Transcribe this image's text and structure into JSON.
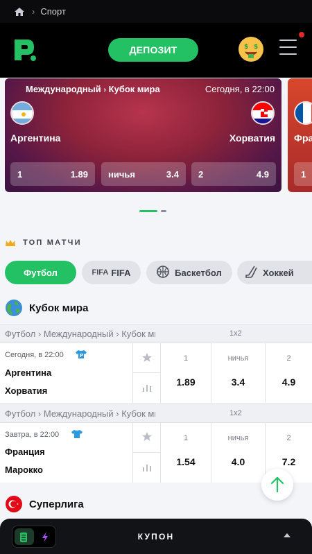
{
  "breadcrumb": {
    "page": "Спорт"
  },
  "header": {
    "deposit_label": "ДЕПОЗИТ"
  },
  "promo": {
    "league": "Международный",
    "tournament": "Кубок мира",
    "time": "Сегодня, в 22:00",
    "home": "Аргентина",
    "away": "Хорватия",
    "odds": [
      {
        "label": "1",
        "value": "1.89"
      },
      {
        "label": "ничья",
        "value": "3.4"
      },
      {
        "label": "2",
        "value": "4.9"
      }
    ],
    "next_away_partial": "Фра",
    "next_odd_partial": "1"
  },
  "top_matches": {
    "title": "ТОП МАТЧИ",
    "chips": [
      {
        "label": "Футбол",
        "active": true
      },
      {
        "label": "FIFA",
        "active": false
      },
      {
        "label": "Баскетбол",
        "active": false
      },
      {
        "label": "Хоккей",
        "active": false
      }
    ]
  },
  "leagues": [
    {
      "name": "Кубок мира",
      "matches": [
        {
          "path": "Футбол › Международный › Кубок мира",
          "market": "1x2",
          "when": "Сегодня, в 22:00",
          "home": "Аргентина",
          "away": "Хорватия",
          "odds": [
            {
              "label": "1",
              "value": "1.89"
            },
            {
              "label": "ничья",
              "value": "3.4"
            },
            {
              "label": "2",
              "value": "4.9"
            }
          ]
        },
        {
          "path": "Футбол › Международный › Кубок мира",
          "market": "1x2",
          "when": "Завтра, в 22:00",
          "home": "Франция",
          "away": "Марокко",
          "odds": [
            {
              "label": "1",
              "value": "1.54"
            },
            {
              "label": "ничья",
              "value": "4.0"
            },
            {
              "label": "2",
              "value": "7.2"
            }
          ]
        }
      ]
    },
    {
      "name": "Суперлига"
    }
  ],
  "coupon": {
    "title": "КУПОН"
  },
  "colors": {
    "accent": "#23c164",
    "header_bg": "#000000",
    "promo_bg": "#8d233a"
  },
  "icons": [
    "home-icon",
    "logo-icon",
    "money-face-icon",
    "menu-icon",
    "crown-icon",
    "globe-icon",
    "star-icon",
    "stats-icon",
    "shirt-icon",
    "arrow-up-icon",
    "coupon-icon",
    "lightning-icon",
    "caret-up-icon"
  ]
}
